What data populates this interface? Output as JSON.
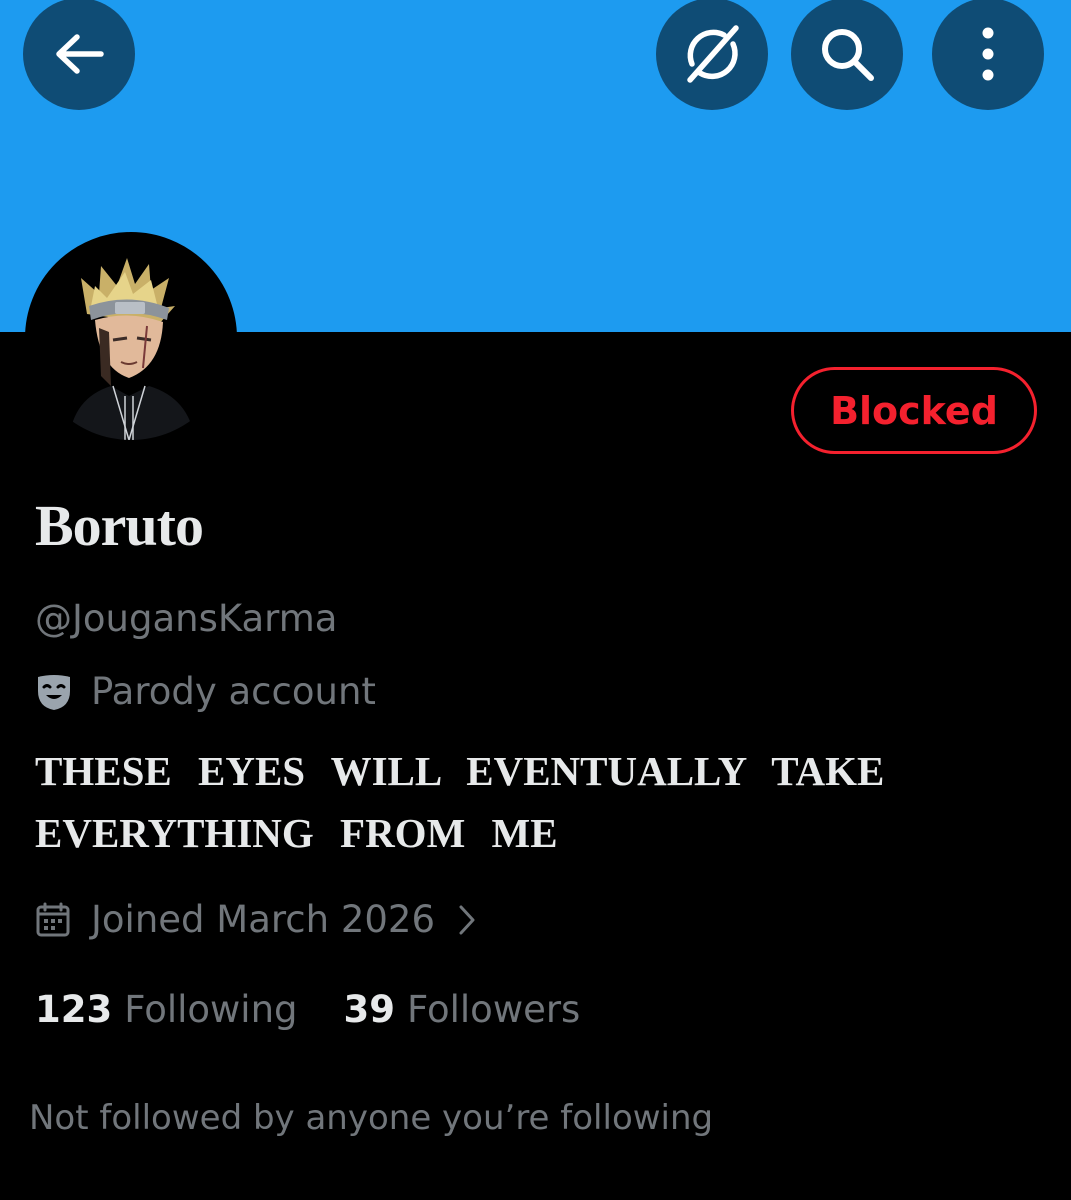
{
  "header": {
    "back_icon": "arrow-left-icon",
    "grok_icon": "grok-icon",
    "search_icon": "search-icon",
    "more_icon": "more-vertical-icon",
    "banner_color": "#1d9bf0",
    "button_color": "#0f4c75"
  },
  "profile": {
    "display_name": "Boruto",
    "handle": "@JougansKarma",
    "parody_label": "Parody account",
    "bio_lines": [
      "THESE EYES WILL EVENTUALLY TAKE",
      "EVERYTHING FROM ME"
    ],
    "joined": "Joined March 2026",
    "blocked_label": "Blocked",
    "blocked_color": "#f4212e"
  },
  "stats": {
    "following_count": "123",
    "following_label": "Following",
    "followers_count": "39",
    "followers_label": "Followers"
  },
  "footer": {
    "not_followed": "Not followed by anyone you’re following"
  }
}
